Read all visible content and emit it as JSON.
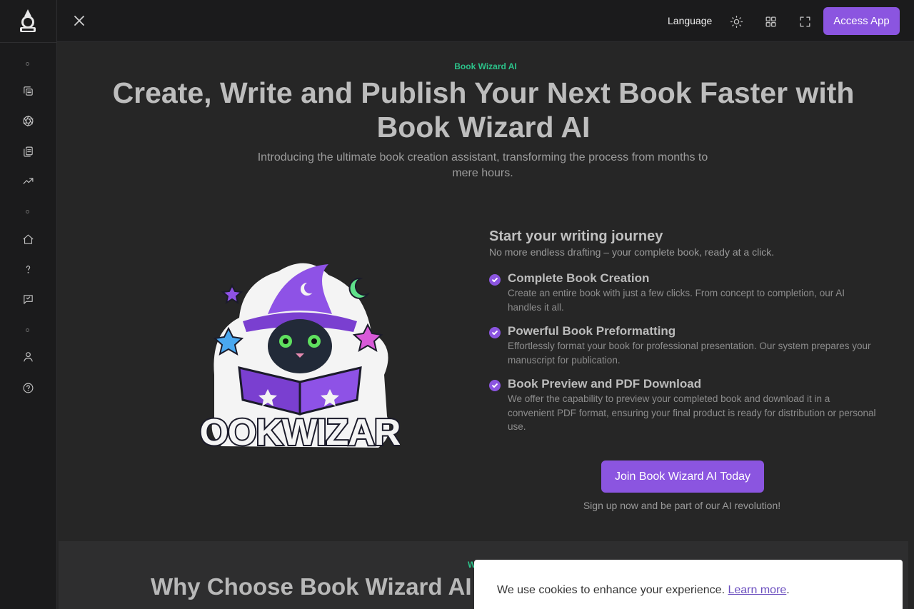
{
  "topbar": {
    "language_label": "Language",
    "access_label": "Access App",
    "accent_color": "#8b55e0"
  },
  "sidebar": {
    "items": [
      {
        "icon": "copy-icon"
      },
      {
        "icon": "aperture-icon"
      },
      {
        "icon": "documents-icon"
      },
      {
        "icon": "trending-up-icon"
      },
      {
        "icon": "home-icon"
      },
      {
        "icon": "question-icon"
      },
      {
        "icon": "message-icon"
      },
      {
        "icon": "user-icon"
      },
      {
        "icon": "help-circle-icon"
      }
    ]
  },
  "hero": {
    "eyebrow": "Book Wizard AI",
    "eyebrow_color": "#2cc28a",
    "title": "Create, Write and Publish Your Next Book Faster with Book Wizard AI",
    "subtitle": "Introducing the ultimate book creation assistant, transforming the process from months to mere hours."
  },
  "logo_text": "BOOKWIZARD",
  "journey": {
    "title": "Start your writing journey",
    "subtitle": "No more endless drafting – your complete book, ready at a click.",
    "features": [
      {
        "title": "Complete Book Creation",
        "desc": "Create an entire book with just a few clicks. From concept to completion, our AI handles it all."
      },
      {
        "title": "Powerful Book Preformatting",
        "desc": "Effortlessly format your book for professional presentation. Our system prepares your manuscript for publication."
      },
      {
        "title": "Book Preview and PDF Download",
        "desc": "We offer the capability to preview your completed book and download it in a convenient PDF format, ensuring your final product is ready for distribution or personal use."
      }
    ],
    "cta": "Join Book Wizard AI Today",
    "cta_note": "Sign up now and be part of our AI revolution!"
  },
  "section2": {
    "eyebrow": "W",
    "title": "Why Choose Book Wizard AI f"
  },
  "cookie": {
    "text": "We use cookies to enhance your experience.",
    "link": "Learn more",
    "suffix": "."
  }
}
